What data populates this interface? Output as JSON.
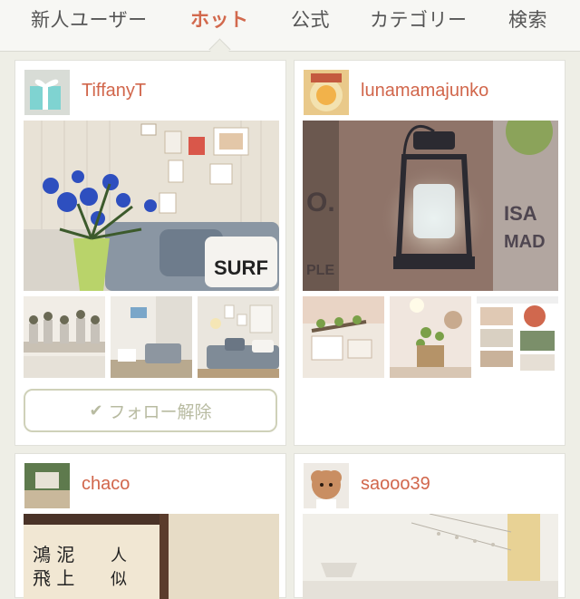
{
  "tabs": [
    {
      "label": "新人ユーザー",
      "active": false
    },
    {
      "label": "ホット",
      "active": true
    },
    {
      "label": "公式",
      "active": false
    },
    {
      "label": "カテゴリー",
      "active": false
    },
    {
      "label": "検索",
      "active": false
    }
  ],
  "colors": {
    "accent": "#d2694d",
    "username": "#d1664b",
    "background": "#eeeee6",
    "follow_button_border": "#cfd1b9"
  },
  "cards": [
    {
      "username": "TiffanyT",
      "follow_label": "フォロー解除",
      "follow_icon": "check-icon"
    },
    {
      "username": "lunamamajunko"
    },
    {
      "username": "chaco"
    },
    {
      "username": "saooo39"
    }
  ]
}
